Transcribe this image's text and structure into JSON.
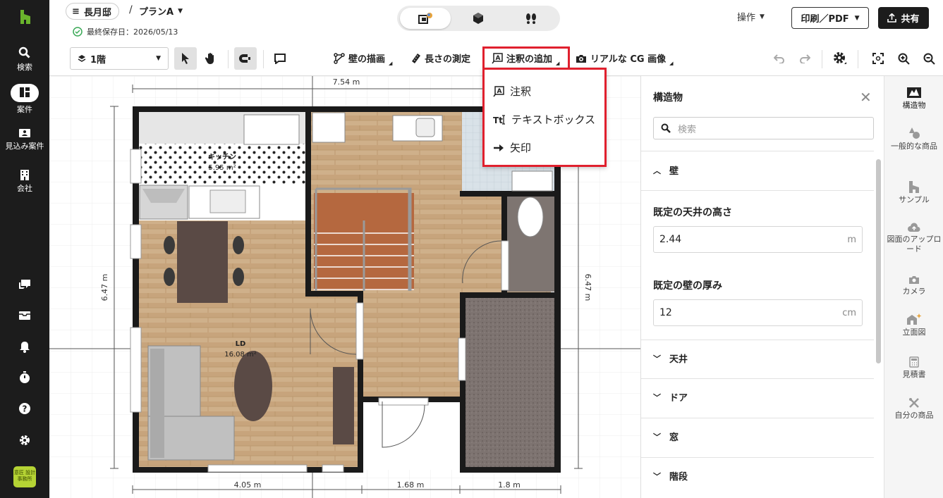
{
  "sidebar": {
    "items": [
      {
        "label": "検索",
        "icon": "search-icon"
      },
      {
        "label": "案件",
        "icon": "projects-icon"
      },
      {
        "label": "見込み案件",
        "icon": "leads-icon"
      },
      {
        "label": "会社",
        "icon": "company-icon"
      }
    ],
    "bottom_icons": [
      "chat-icon",
      "inbox-icon",
      "bell-icon",
      "timer-icon",
      "help-icon",
      "settings-icon"
    ],
    "avatar_text": "意匠 設計事務所"
  },
  "header": {
    "project_name": "長月邸",
    "separator": "/",
    "plan_name": "プランA",
    "saved_text": "最終保存日：2026/05/13",
    "view_modes": [
      "2d-3d-view-icon",
      "3d-box-icon",
      "walkthrough-icon"
    ],
    "operations_label": "操作",
    "print_label": "印刷／PDF",
    "share_label": "共有"
  },
  "toolbar": {
    "floor": "1階",
    "tools": {
      "draw_wall": "壁の描画",
      "measure": "長さの測定",
      "add_annotation": "注釈の追加",
      "realistic_cg": "リアルな CG 画像"
    }
  },
  "annotation_menu": {
    "items": [
      {
        "label": "注釈",
        "icon": "annotation-icon"
      },
      {
        "label": "テキストボックス",
        "icon": "textbox-icon"
      },
      {
        "label": "矢印",
        "icon": "arrow-icon"
      }
    ]
  },
  "floorplan": {
    "dimensions": {
      "top": "7.54 m",
      "left": "6.47 m",
      "right": "6.47 m",
      "bottom_1": "4.05 m",
      "bottom_2": "1.68 m",
      "bottom_3": "1.8 m"
    },
    "rooms": [
      {
        "name": "キッチン",
        "area": "5.95 m²"
      },
      {
        "name": "LD",
        "area": "16.08 m²"
      }
    ]
  },
  "panel": {
    "title": "構造物",
    "search_placeholder": "検索",
    "section_wall": "壁",
    "ceiling_height_label": "既定の天井の高さ",
    "ceiling_height_value": "2.44",
    "ceiling_height_unit": "m",
    "wall_thickness_label": "既定の壁の厚み",
    "wall_thickness_value": "12",
    "wall_thickness_unit": "cm",
    "collapsed_sections": [
      "天井",
      "ドア",
      "窓",
      "階段"
    ]
  },
  "rightbar": {
    "items": [
      {
        "label": "構造物",
        "icon": "structure-icon"
      },
      {
        "label": "一般的な商品",
        "icon": "generic-products-icon"
      },
      {
        "label": "サンプル",
        "icon": "sample-icon"
      },
      {
        "label": "図面のアップロード",
        "icon": "upload-icon"
      },
      {
        "label": "カメラ",
        "icon": "camera-icon"
      },
      {
        "label": "立面図",
        "icon": "elevation-icon"
      },
      {
        "label": "見積書",
        "icon": "estimate-icon"
      },
      {
        "label": "自分の商品",
        "icon": "my-products-icon"
      }
    ]
  },
  "colors": {
    "accent_green": "#6ab42c",
    "highlight_red": "#e0202e",
    "dark": "#1c1c1c"
  }
}
